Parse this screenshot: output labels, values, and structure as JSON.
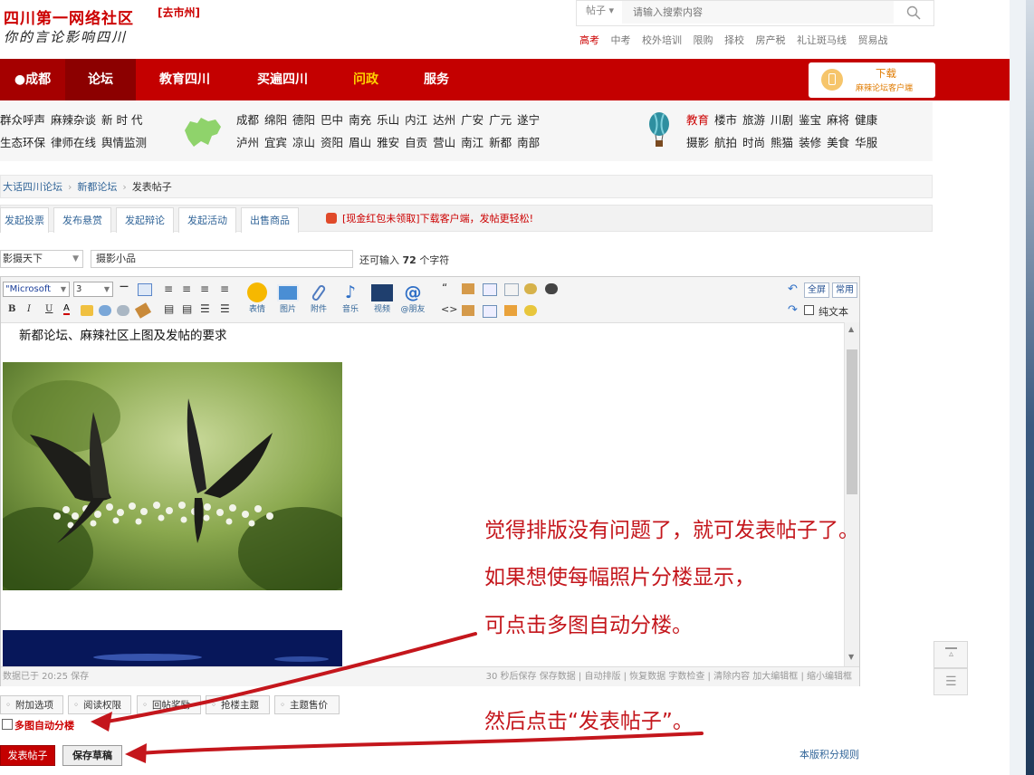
{
  "header": {
    "site_name": "四川第一网络社区",
    "slogan": "你的言论影响四川",
    "city_switch": "[去市州]",
    "search": {
      "type": "帖子",
      "placeholder": "请输入搜索内容"
    },
    "hotlinks": [
      "高考",
      "中考",
      "校外培训",
      "限购",
      "择校",
      "房产税",
      "礼让斑马线",
      "贸易战"
    ]
  },
  "nav": {
    "location": "成都",
    "items": [
      "论坛",
      "教育四川",
      "买遍四川",
      "问政",
      "服务"
    ],
    "download": {
      "title": "下载",
      "subtitle": "麻辣论坛客户端"
    }
  },
  "quick_links": {
    "left_row1": [
      "群众呼声",
      "麻辣杂谈",
      "新 时 代"
    ],
    "left_row2": [
      "生态环保",
      "律师在线",
      "舆情监测"
    ],
    "cities_row1": [
      "成都",
      "绵阳",
      "德阳",
      "巴中",
      "南充",
      "乐山",
      "内江",
      "达州",
      "广安",
      "广元",
      "遂宁"
    ],
    "cities_row2": [
      "泸州",
      "宜宾",
      "凉山",
      "资阳",
      "眉山",
      "雅安",
      "自贡",
      "营山",
      "南江",
      "新都",
      "南部"
    ],
    "topics_row1": [
      "教育",
      "楼市",
      "旅游",
      "川剧",
      "鉴宝",
      "麻将",
      "健康"
    ],
    "topics_row2": [
      "摄影",
      "航拍",
      "时尚",
      "熊猫",
      "装修",
      "美食",
      "华服"
    ]
  },
  "breadcrumb": [
    "大话四川论坛",
    "新都论坛",
    "发表帖子"
  ],
  "post_tabs": [
    "发起投票",
    "发布悬赏",
    "发起辩论",
    "发起活动",
    "出售商品"
  ],
  "promo": "[现金红包未领取]下载客户端，发帖更轻松!",
  "title_row": {
    "type_value": "影摄天下",
    "title_value": "摄影小品",
    "hint_prefix": "还可输入",
    "hint_count": "72",
    "hint_suffix": "个字符"
  },
  "toolbar": {
    "font": "\"Microsoft",
    "size": "3",
    "insert_buttons": [
      "表情",
      "图片",
      "附件",
      "音乐",
      "视频",
      "@朋友"
    ],
    "fullscreen": "全屏",
    "common": "常用",
    "plain_text": "纯文本"
  },
  "editor": {
    "first_line": "新都论坛、麻辣社区上图及发帖的要求"
  },
  "statusbar": {
    "saved": "数据已于 20:25 保存",
    "actions": "30 秒后保存 保存数据 | 自动排版 | 恢复数据   字数检查 | 清除内容   加大编辑框 | 缩小编辑框"
  },
  "options": [
    "附加选项",
    "阅读权限",
    "回帖奖励",
    "抢楼主题",
    "主题售价"
  ],
  "auto_floor": "多图自动分楼",
  "buttons": {
    "submit": "发表帖子",
    "draft": "保存草稿"
  },
  "rules_link": "本版积分规则",
  "annotations": {
    "line1": "觉得排版没有问题了，就可发表帖子了。",
    "line2": "如果想使每幅照片分楼显示，",
    "line3": "可点击多图自动分楼。",
    "line4": "然后点击“发表帖子”。"
  },
  "colors": {
    "brand_red": "#c40000",
    "annotation_red": "#c4161c",
    "link_blue": "#336699"
  }
}
